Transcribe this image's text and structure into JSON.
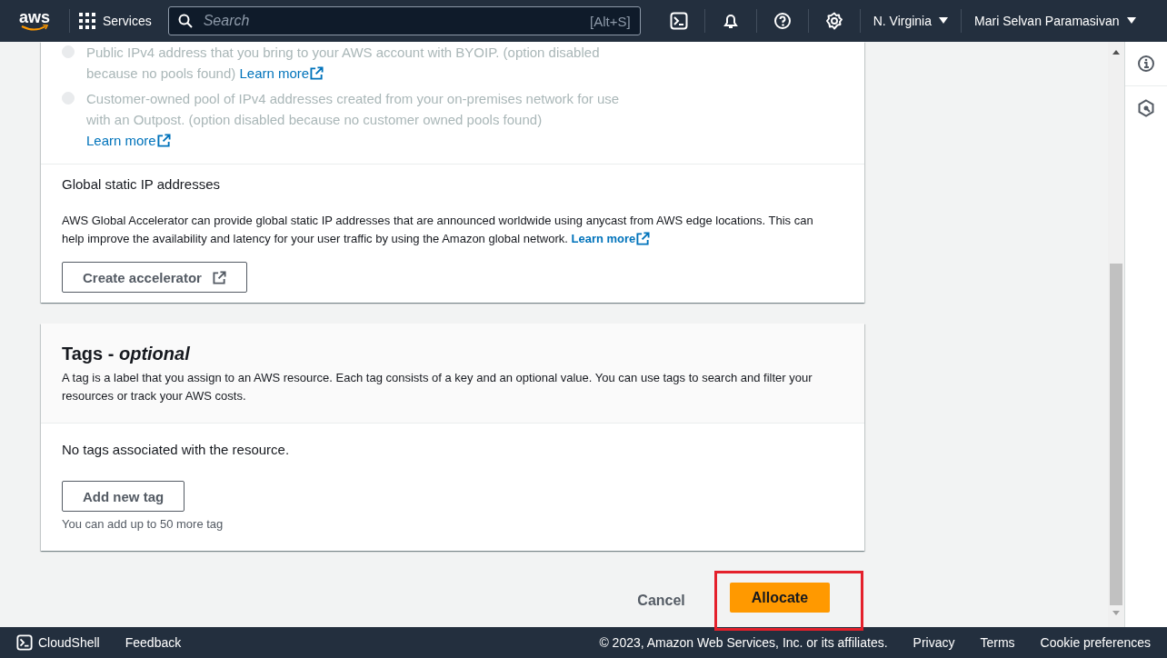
{
  "nav": {
    "logo": "aws",
    "services": "Services",
    "search": {
      "placeholder": "Search",
      "shortcut": "[Alt+S]"
    },
    "region": "N. Virginia",
    "user": "Mari Selvan Paramasivan"
  },
  "pool_options": [
    {
      "text": "Public IPv4 address that you bring to your AWS account with BYOIP. (option disabled because no pools found)",
      "link": "Learn more",
      "disabled": true,
      "selected": false
    },
    {
      "text": "Customer-owned pool of IPv4 addresses created from your on-premises network for use with an Outpost. (option disabled because no customer owned pools found)",
      "link": "Learn more",
      "disabled": true,
      "selected": false
    }
  ],
  "global_ip": {
    "title": "Global static IP addresses",
    "description": "AWS Global Accelerator can provide global static IP addresses that are announced worldwide using anycast from AWS edge locations. This can help improve the availability and latency for your user traffic by using the Amazon global network.",
    "link": "Learn more",
    "button": "Create accelerator"
  },
  "tags": {
    "title": "Tags - ",
    "title_suffix": "optional",
    "description": "A tag is a label that you assign to an AWS resource. Each tag consists of a key and an optional value. You can use tags to search and filter your resources or track your AWS costs.",
    "empty": "No tags associated with the resource.",
    "button": "Add new tag",
    "note": "You can add up to 50 more tag"
  },
  "actions": {
    "cancel": "Cancel",
    "submit": "Allocate"
  },
  "footer": {
    "cloudshell": "CloudShell",
    "feedback": "Feedback",
    "copyright": "© 2023, Amazon Web Services, Inc. or its affiliates.",
    "links": [
      "Privacy",
      "Terms",
      "Cookie preferences"
    ]
  }
}
